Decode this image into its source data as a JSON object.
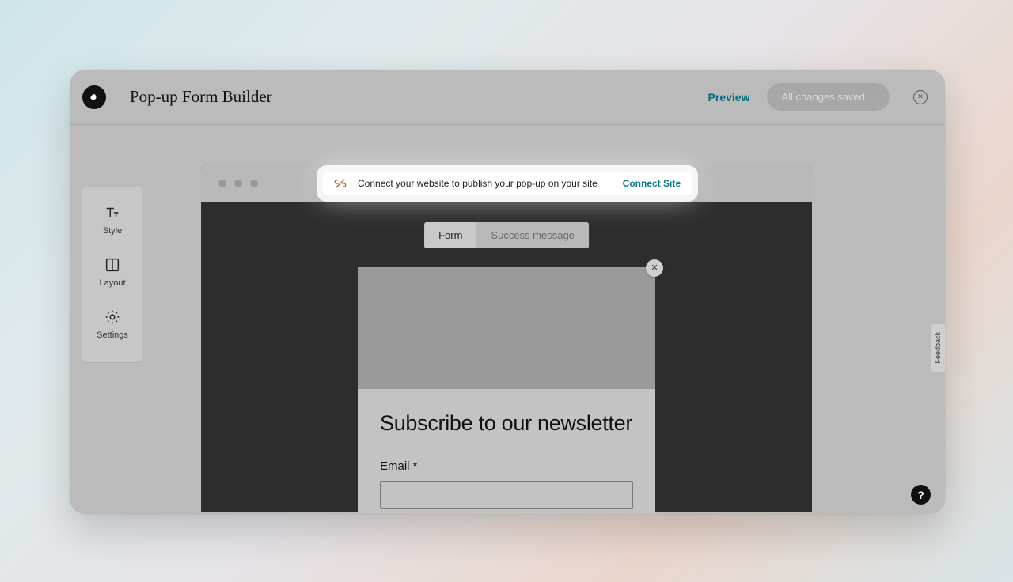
{
  "header": {
    "title": "Pop-up Form Builder",
    "preview_label": "Preview",
    "save_status": "All changes saved…"
  },
  "sidebar": {
    "items": [
      {
        "label": "Style"
      },
      {
        "label": "Layout"
      },
      {
        "label": "Settings"
      }
    ]
  },
  "connect_banner": {
    "message": "Connect your website to publish your pop-up on your site",
    "cta": "Connect Site"
  },
  "tabs": {
    "form": "Form",
    "success": "Success message"
  },
  "popup": {
    "title": "Subscribe to our newsletter",
    "email_label": "Email *"
  },
  "feedback_label": "Feedback",
  "help_label": "?"
}
